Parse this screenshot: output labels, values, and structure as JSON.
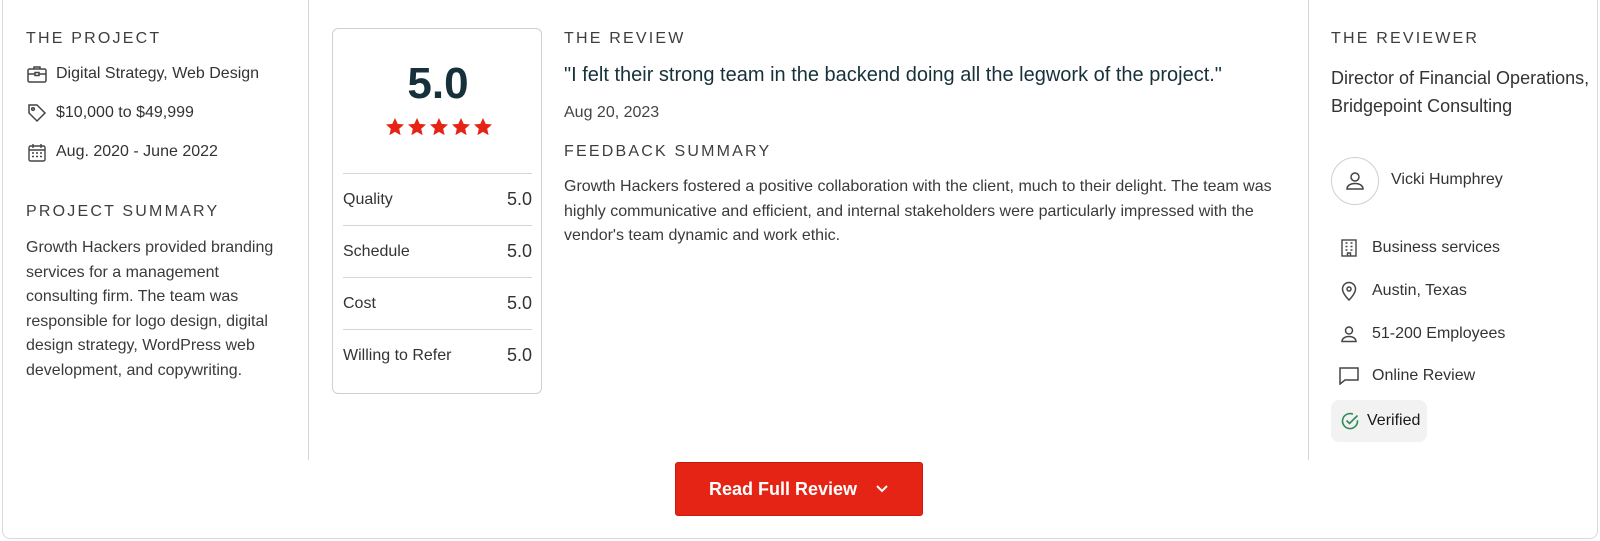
{
  "project": {
    "heading": "THE PROJECT",
    "service": "Digital Strategy, Web Design",
    "budget": "$10,000 to $49,999",
    "dates": "Aug. 2020 - June 2022",
    "summary_heading": "PROJECT SUMMARY",
    "summary": "Growth Hackers provided branding services for a management consulting firm. The team was responsible for logo design, digital design strategy, WordPress web development, and copywriting."
  },
  "rating": {
    "overall": "5.0",
    "stars": 5,
    "rows": [
      {
        "label": "Quality",
        "value": "5.0"
      },
      {
        "label": "Schedule",
        "value": "5.0"
      },
      {
        "label": "Cost",
        "value": "5.0"
      },
      {
        "label": "Willing to Refer",
        "value": "5.0"
      }
    ]
  },
  "review": {
    "heading": "THE REVIEW",
    "quote": "\"I felt their strong team in the backend doing all the legwork of the project.\"",
    "date": "Aug 20, 2023",
    "feedback_heading": "FEEDBACK SUMMARY",
    "feedback": "Growth Hackers fostered a positive collaboration with the client, much to their delight. The team was highly communicative and efficient, and internal stakeholders were particularly impressed with the vendor's team dynamic and work ethic."
  },
  "reviewer": {
    "heading": "THE REVIEWER",
    "title": "Director of Financial Operations, Bridgepoint Consulting",
    "name": "Vicki Humphrey",
    "industry": "Business services",
    "location": "Austin, Texas",
    "size": "51-200 Employees",
    "review_type": "Online Review",
    "verified": "Verified"
  },
  "button": {
    "label": "Read Full Review"
  },
  "colors": {
    "accent": "#e62415",
    "star": "#e62415",
    "verified": "#2e8b57",
    "score": "#17313b"
  }
}
